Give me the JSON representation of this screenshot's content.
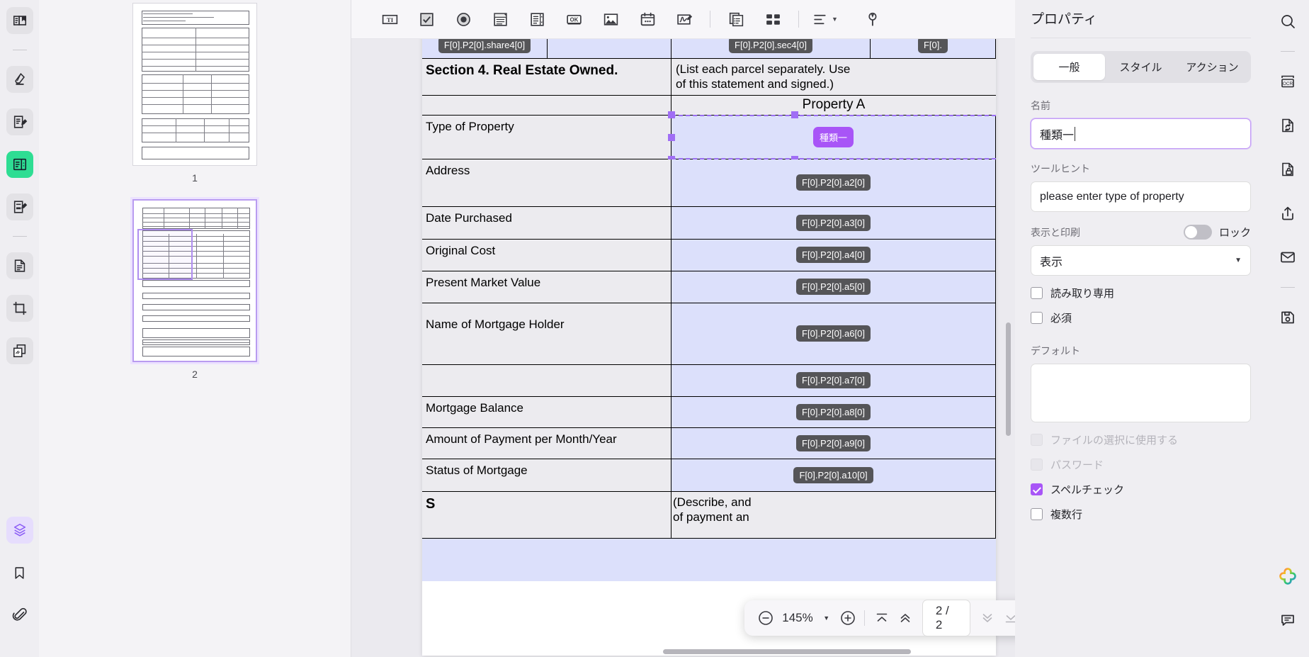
{
  "left_rail": {
    "items": [
      {
        "name": "read-mode-icon",
        "label": "読み取りモード"
      },
      {
        "name": "highlighter-icon",
        "label": "ハイライト"
      },
      {
        "name": "annotate-icon",
        "label": "注釈"
      },
      {
        "name": "form-field-icon",
        "label": "フォーム",
        "state": "active-green"
      },
      {
        "name": "edit-text-icon",
        "label": "テキスト編集"
      },
      {
        "name": "page-organize-icon",
        "label": "ページ"
      },
      {
        "name": "crop-icon",
        "label": "トリミング"
      },
      {
        "name": "compare-icon",
        "label": "比較"
      },
      {
        "name": "layers-icon",
        "label": "レイヤー",
        "state": "active-purple"
      },
      {
        "name": "bookmark-icon",
        "label": "ブックマーク"
      },
      {
        "name": "attachment-icon",
        "label": "添付ファイル"
      }
    ]
  },
  "thumbnails": {
    "pages": [
      {
        "number": "1",
        "selected": false
      },
      {
        "number": "2",
        "selected": true
      }
    ]
  },
  "toolbar": {
    "items": [
      {
        "name": "text-field-tool",
        "label": "テキストフィールド",
        "glyph": "TI"
      },
      {
        "name": "checkbox-tool",
        "label": "チェックボックス"
      },
      {
        "name": "radio-button-tool",
        "label": "ラジオボタン"
      },
      {
        "name": "combo-box-tool",
        "label": "コンボボックス"
      },
      {
        "name": "list-box-tool",
        "label": "リストボックス"
      },
      {
        "name": "push-button-tool",
        "label": "プッシュボタン",
        "glyph": "OK"
      },
      {
        "name": "image-field-tool",
        "label": "画像フィールド"
      },
      {
        "name": "date-field-tool",
        "label": "日付フィールド"
      },
      {
        "name": "signature-field-tool",
        "label": "署名フィールド"
      },
      {
        "name": "duplicate-fields-tool",
        "label": "フィールドの複製"
      },
      {
        "name": "tab-order-tool",
        "label": "タブ順序"
      },
      {
        "name": "align-tool",
        "label": "整列"
      },
      {
        "name": "form-settings-tool",
        "label": "フォーム設定"
      }
    ]
  },
  "document": {
    "section_tags_top": [
      "F[0].P2[0].share4[0]",
      "F[0].P2[0].sec4[0]",
      "F[0]."
    ],
    "section_title": "Section 4. Real Estate Owned.",
    "section_note_line1": "(List each parcel separately.  Use",
    "section_note_line2": "of this statement and signed.)",
    "property_header": "Property A",
    "rows": [
      {
        "label": "Type of Property",
        "tag": "種類一",
        "tag_style": "purple"
      },
      {
        "label": "Address",
        "tag": "F[0].P2[0].a2[0]",
        "tag_style": "dark"
      },
      {
        "label": "Date Purchased",
        "tag": "F[0].P2[0].a3[0]",
        "tag_style": "dark"
      },
      {
        "label": "Original Cost",
        "tag": "F[0].P2[0].a4[0]",
        "tag_style": "dark"
      },
      {
        "label": "Present Market Value",
        "tag": "F[0].P2[0].a5[0]",
        "tag_style": "dark"
      },
      {
        "label": "Name of Mortgage Holder",
        "tag": "F[0].P2[0].a6[0]",
        "tag_style": "dark"
      },
      {
        "label": "",
        "tag": "F[0].P2[0].a7[0]",
        "tag_style": "dark"
      },
      {
        "label": "Mortgage Balance",
        "tag": "F[0].P2[0].a8[0]",
        "tag_style": "dark"
      },
      {
        "label": "Amount of Payment per Month/Year",
        "tag": "F[0].P2[0].a9[0]",
        "tag_style": "dark"
      },
      {
        "label": "Status of Mortgage",
        "tag": "F[0].P2[0].a10[0]",
        "tag_style": "dark"
      }
    ],
    "footer_left": "S",
    "footer_right_line1": "(Describe, and",
    "footer_right_line2": "of payment an"
  },
  "zoombar": {
    "zoom_out": "−",
    "zoom_value": "145%",
    "zoom_in": "+",
    "first_page": "first-page",
    "prev_page": "prev-page",
    "page_indicator": "2 / 2",
    "next_page": "next-page",
    "last_page": "last-page",
    "close": "×"
  },
  "properties": {
    "title": "プロパティ",
    "tabs": [
      {
        "label": "一般",
        "active": true
      },
      {
        "label": "スタイル",
        "active": false
      },
      {
        "label": "アクション",
        "active": false
      }
    ],
    "name_label": "名前",
    "name_value": "種類一",
    "tooltip_label": "ツールヒント",
    "tooltip_value": "please enter type of property",
    "display_print_label": "表示と印刷",
    "lock_label": "ロック",
    "lock_on": false,
    "visibility_value": "表示",
    "checkbox_readonly": {
      "label": "読み取り専用",
      "checked": false,
      "disabled": false
    },
    "checkbox_required": {
      "label": "必須",
      "checked": false,
      "disabled": false
    },
    "default_label": "デフォルト",
    "default_value": "",
    "checkbox_file_select": {
      "label": "ファイルの選択に使用する",
      "checked": false,
      "disabled": true
    },
    "checkbox_password": {
      "label": "パスワード",
      "checked": false,
      "disabled": true
    },
    "checkbox_spellcheck": {
      "label": "スペルチェック",
      "checked": true,
      "disabled": false
    },
    "checkbox_multiline": {
      "label": "複数行",
      "checked": false,
      "disabled": false
    }
  },
  "right_rail": {
    "items": [
      {
        "name": "search-icon",
        "label": "検索"
      },
      {
        "name": "ocr-icon",
        "label": "OCR"
      },
      {
        "name": "convert-icon",
        "label": "変換"
      },
      {
        "name": "protect-icon",
        "label": "保護"
      },
      {
        "name": "share-icon",
        "label": "共有"
      },
      {
        "name": "email-icon",
        "label": "メール"
      },
      {
        "name": "save-icon",
        "label": "保存"
      },
      {
        "name": "ai-assistant-icon",
        "label": "AIアシスタント"
      },
      {
        "name": "comment-icon",
        "label": "コメント"
      }
    ]
  },
  "colors": {
    "accent_purple": "#a855f7",
    "active_green": "#2edd93",
    "field_blue": "#dce0fb",
    "tag_dark": "#555558"
  }
}
